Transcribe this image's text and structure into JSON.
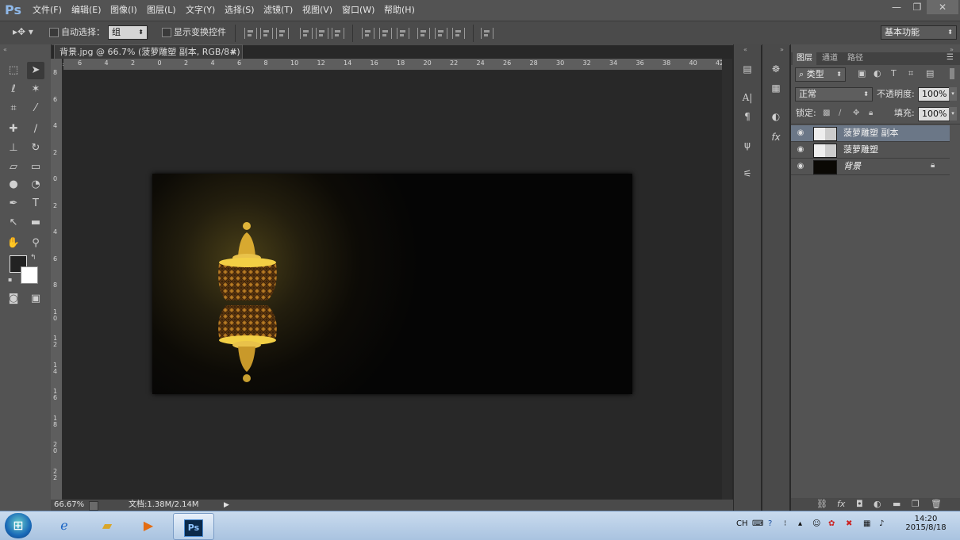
{
  "app": {
    "logo": "Ps"
  },
  "menu": [
    "文件(F)",
    "编辑(E)",
    "图像(I)",
    "图层(L)",
    "文字(Y)",
    "选择(S)",
    "滤镜(T)",
    "视图(V)",
    "窗口(W)",
    "帮助(H)"
  ],
  "window_controls": {
    "minimize": "—",
    "restore": "❐",
    "close": "✕"
  },
  "options": {
    "auto_select_label": "自动选择：",
    "auto_select_value": "组",
    "show_transform_label": "显示变换控件",
    "workspace": "基本功能"
  },
  "tools": [
    "move-tool",
    "marquee-tool",
    "lasso-tool",
    "magic-wand-tool",
    "crop-tool",
    "eyedropper-tool",
    "healing-tool",
    "brush-tool",
    "stamp-tool",
    "history-brush-tool",
    "eraser-tool",
    "gradient-tool",
    "blur-tool",
    "dodge-tool",
    "pen-tool",
    "type-tool",
    "path-select-tool",
    "shape-tool",
    "hand-tool",
    "zoom-tool"
  ],
  "document": {
    "tab_title": "背景.jpg @ 66.7% (菠萝雕塑 副本, RGB/8#) *",
    "close": "×"
  },
  "ruler_h": [
    "6",
    "4",
    "2",
    "0",
    "2",
    "4",
    "6",
    "8",
    "10",
    "12",
    "14",
    "16",
    "18",
    "20",
    "22",
    "24",
    "26",
    "28",
    "30",
    "32",
    "34",
    "36",
    "38",
    "40",
    "42"
  ],
  "ruler_v": [
    "8",
    "6",
    "4",
    "2",
    "0",
    "2",
    "4",
    "6",
    "8",
    "1 0",
    "1 2",
    "1 4",
    "1 6",
    "1 8",
    "2 0",
    "2 2"
  ],
  "status": {
    "zoom": "66.67%",
    "doc": "文档:1.38M/2.14M"
  },
  "layers_panel": {
    "tabs": [
      "图层",
      "通道",
      "路径"
    ],
    "filter_kind": "类型",
    "blend_mode": "正常",
    "opacity_label": "不透明度:",
    "opacity_value": "100%",
    "lock_label": "锁定:",
    "fill_label": "填充:",
    "fill_value": "100%",
    "layers": [
      {
        "name": "菠萝雕塑 副本",
        "selected": true
      },
      {
        "name": "菠萝雕塑",
        "selected": false
      },
      {
        "name": "背景",
        "selected": false
      }
    ]
  },
  "taskbar": {
    "ime": "CH",
    "time": "14:20",
    "date": "2015/8/18",
    "ps_label": "Ps"
  }
}
